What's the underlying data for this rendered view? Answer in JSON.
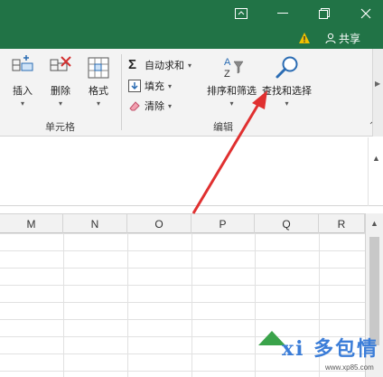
{
  "ribbon": {
    "cells_group": {
      "label": "单元格",
      "insert": "插入",
      "delete": "删除",
      "format": "格式"
    },
    "editing_group": {
      "label": "编辑",
      "autosum": "自动求和",
      "fill": "填充",
      "clear": "清除",
      "sort_filter": "排序和筛选",
      "find_select": "查找和选择"
    }
  },
  "titlebar": {
    "share": "共享"
  },
  "grid": {
    "columns": [
      "M",
      "N",
      "O",
      "P",
      "Q",
      "R"
    ]
  },
  "watermark": {
    "text": "xi 多包情",
    "url": "www.xp85.com"
  },
  "colors": {
    "title_bg": "#217346",
    "arrow": "#e03030",
    "warning": "#f0c000"
  },
  "icons": {
    "ribbon_display_options": "ribbon-display-options-icon",
    "minimize": "minimize-icon",
    "restore": "restore-icon",
    "close": "close-icon",
    "warning": "warning-icon",
    "share": "person-icon"
  }
}
